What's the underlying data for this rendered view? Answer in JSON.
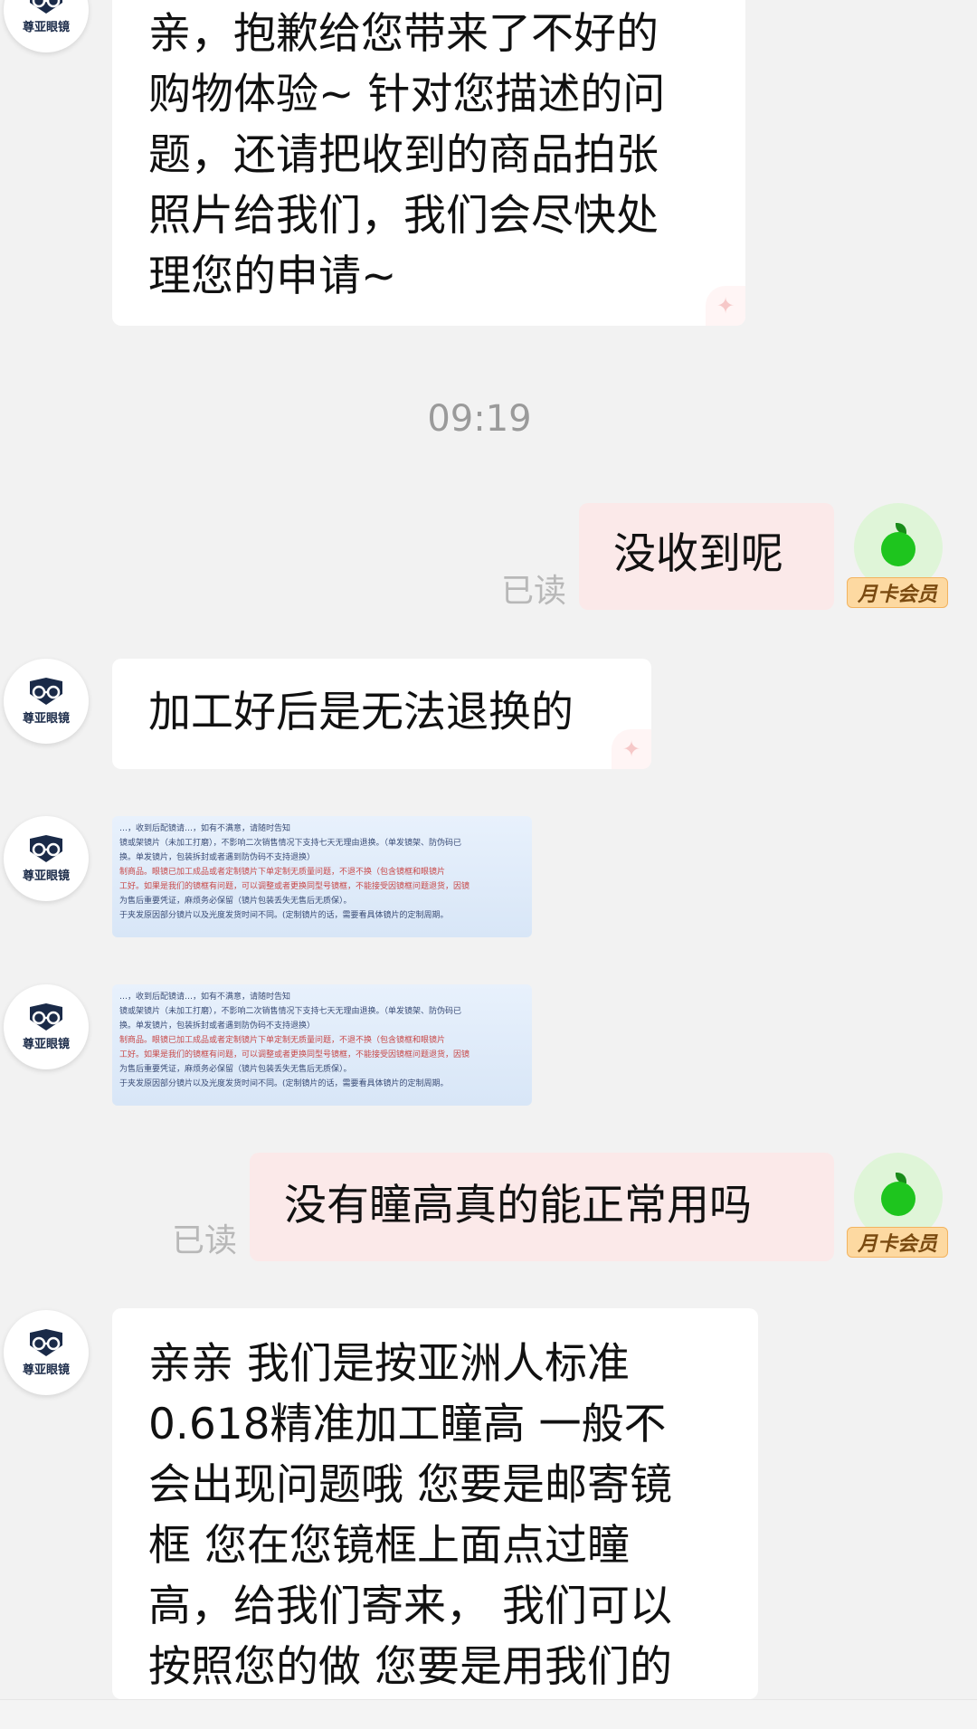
{
  "shop": {
    "avatar_label": "尊亚眼镜"
  },
  "user": {
    "member_badge": "月卡会员"
  },
  "read_label": "已读",
  "timestamp": "09:19",
  "messages": {
    "m1": [
      "亲，抱歉给您带来了不好的",
      "购物体验~ 针对您描述的问",
      "题，还请把收到的商品拍张",
      "照片给我们，我们会尽快处",
      "理您的申请~"
    ],
    "m2": "没收到呢",
    "m3": "加工好后是无法退换的",
    "m4_image_lines": [
      "…，收到后配镜请…，如有不满意，请随时告知",
      "镜或架镜片（未加工打磨），不影响二次销售情况下支持七天无理由退换。（单发镜架、防伪码已",
      "换。单发镜片，包装拆封或者遇到防伪码不支持退换）",
      "制商品。眼镜已加工成品或者定制镜片下单定制无质量问题，不退不换（包含镜框和眼镜片",
      "工好。如果是我们的镜框有问题，可以调整或者更换同型号镜框，不能接受因镜框问题退货，因镜",
      "为售后重要凭证，麻烦务必保留（镜片包装丢失无售后无质保）。",
      "于夹发原因部分镜片以及光度发货时间不同。(定制镜片的话，需要看具体镜片的定制周期。"
    ],
    "m5_image_lines": [
      "…，收到后配镜请…，如有不满意，请随时告知",
      "镜或架镜片（未加工打磨），不影响二次销售情况下支持七天无理由退换。（单发镜架、防伪码已",
      "换。单发镜片，包装拆封或者遇到防伪码不支持退换）",
      "制商品。眼镜已加工成品或者定制镜片下单定制无质量问题，不退不换（包含镜框和眼镜片",
      "工好。如果是我们的镜框有问题，可以调整或者更换同型号镜框，不能接受因镜框问题退货，因镜",
      "为售后重要凭证，麻烦务必保留（镜片包装丢失无售后无质保）。",
      "于夹发原因部分镜片以及光度发货时间不同。(定制镜片的话，需要看具体镜片的定制周期。"
    ],
    "m6": "没有瞳高真的能正常用吗",
    "m7": [
      "亲亲 我们是按亚洲人标准",
      "0.618精准加工瞳高 一般不",
      "会出现问题哦 您要是邮寄镜",
      "框 您在您镜框上面点过瞳",
      "高，给我们寄来， 我们可以",
      "按照您的做 您要是用我们的"
    ]
  },
  "colors": {
    "background": "#f2f2f2",
    "incoming_bubble": "#ffffff",
    "outgoing_bubble": "#fbe9e9",
    "read_text": "#b8b8b8",
    "member_badge": "#fdd9a1"
  },
  "icons": {
    "shop_logo": "glasses-logo-icon",
    "user_avatar": "apple-avatar-icon"
  }
}
